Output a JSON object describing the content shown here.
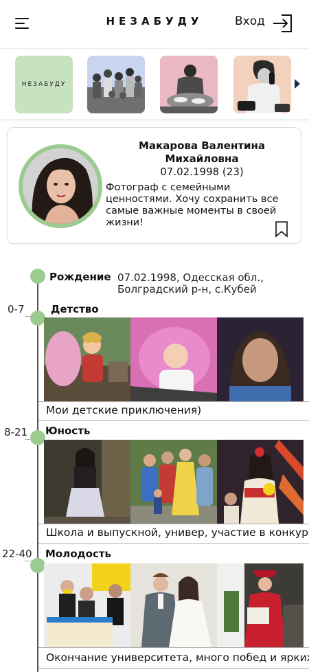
{
  "header": {
    "brand": "НЕЗАБУДУ",
    "login_label": "Вход"
  },
  "stories": {
    "logo_label": "НЕЗАБУДУ",
    "items": [
      "logo",
      "family-photo",
      "kitchen-photo",
      "phone-photo"
    ]
  },
  "profile": {
    "name": "Макарова Валентина Михайловна",
    "birth": "07.02.1998 (23)",
    "bio": "Фотограф с семейными ценностями. Хочу сохранить все самые важные моменты в своей жизни!"
  },
  "timeline": {
    "birth": {
      "title": "Рождение",
      "text_line1": "07.02.1998, Одесская обл.,",
      "text_line2": "Болградский р-н, с.Кубей"
    },
    "periods": [
      {
        "age": "0-7",
        "title": "Детство",
        "caption": "Мои детские приключения)"
      },
      {
        "age": "8-21",
        "title": "Юность",
        "caption": "Школа и выпускной, универ, участие в конкурсах"
      },
      {
        "age": "22-40",
        "title": "Молодость",
        "caption": "Окончание университета, много побед и ярких моментов"
      }
    ]
  },
  "colors": {
    "accent_green": "#9ccb8f",
    "logo_tile": "#c7e2bf",
    "arrow": "#1d2a48"
  }
}
